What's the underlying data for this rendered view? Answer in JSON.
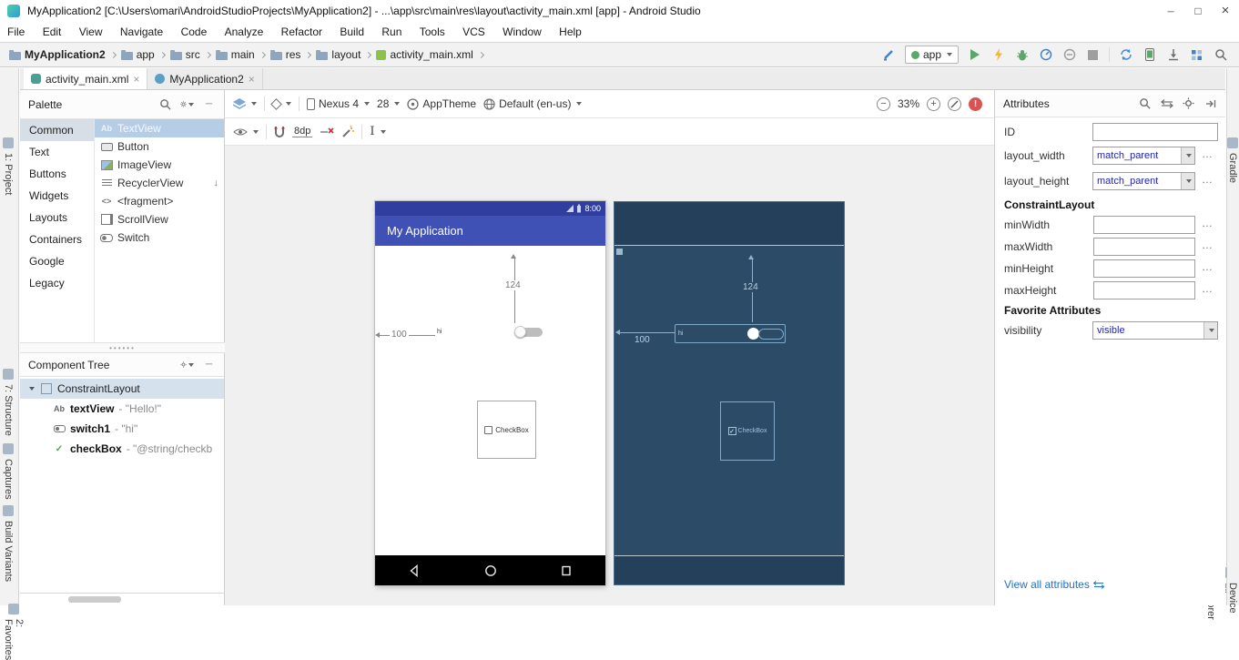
{
  "window": {
    "title": "MyApplication2 [C:\\Users\\omari\\AndroidStudioProjects\\MyApplication2] - ...\\app\\src\\main\\res\\layout\\activity_main.xml [app] - Android Studio"
  },
  "menu": {
    "items": [
      "File",
      "Edit",
      "View",
      "Navigate",
      "Code",
      "Analyze",
      "Refactor",
      "Build",
      "Run",
      "Tools",
      "VCS",
      "Window",
      "Help"
    ]
  },
  "breadcrumb": {
    "items": [
      "MyApplication2",
      "app",
      "src",
      "main",
      "res",
      "layout",
      "activity_main.xml"
    ]
  },
  "toolbar": {
    "run_config": "app"
  },
  "tabs": [
    {
      "label": "activity_main.xml"
    },
    {
      "label": "MyApplication2"
    }
  ],
  "tool_strips": {
    "left": [
      "1: Project",
      "7: Structure",
      "Captures",
      "Build Variants",
      "2: Favorites"
    ],
    "right": [
      "Gradle",
      "Device File Explorer"
    ]
  },
  "palette": {
    "title": "Palette",
    "categories": [
      "Common",
      "Text",
      "Buttons",
      "Widgets",
      "Layouts",
      "Containers",
      "Google",
      "Legacy"
    ],
    "items": [
      "TextView",
      "Button",
      "ImageView",
      "RecyclerView",
      "<fragment>",
      "ScrollView",
      "Switch"
    ]
  },
  "component_tree": {
    "title": "Component Tree",
    "root": "ConstraintLayout",
    "nodes": [
      {
        "name": "textView",
        "value": "- \"Hello!\""
      },
      {
        "name": "switch1",
        "value": "- \"hi\""
      },
      {
        "name": "checkBox",
        "value": "- \"@string/checkb"
      }
    ]
  },
  "design_toolbar": {
    "device": "Nexus 4",
    "api": "28",
    "theme": "AppTheme",
    "locale": "Default (en-us)",
    "zoom": "33%",
    "margin": "8dp"
  },
  "design": {
    "app_title": "My Application",
    "time": "8:00",
    "vertical_constraint": "124",
    "horizontal_constraint": "100",
    "switch_text": "hi",
    "checkbox_text": "CheckBox"
  },
  "attributes": {
    "title": "Attributes",
    "id_label": "ID",
    "id_value": "",
    "layout_width_label": "layout_width",
    "layout_width_value": "match_parent",
    "layout_height_label": "layout_height",
    "layout_height_value": "match_parent",
    "section_constraintlayout": "ConstraintLayout",
    "min_width_label": "minWidth",
    "min_width_value": "",
    "max_width_label": "maxWidth",
    "max_width_value": "",
    "min_height_label": "minHeight",
    "min_height_value": "",
    "max_height_label": "maxHeight",
    "max_height_value": "",
    "favorites_title": "Favorite Attributes",
    "visibility_label": "visibility",
    "visibility_value": "visible",
    "view_all": "View all attributes"
  },
  "colors": {
    "app_bar": "#3F51B5",
    "status_bar": "#303F9F",
    "blueprint_bg": "#2C4B66",
    "selection_blue": "#B6CDE6",
    "value_blue": "#2222BB",
    "run_green": "#59A869",
    "error_red": "#D9534F"
  },
  "icons": {
    "search": "magnifier",
    "gear": "gear",
    "close": "x",
    "caret": "triangle-down",
    "download": "arrow-down",
    "error": "exclamation"
  }
}
